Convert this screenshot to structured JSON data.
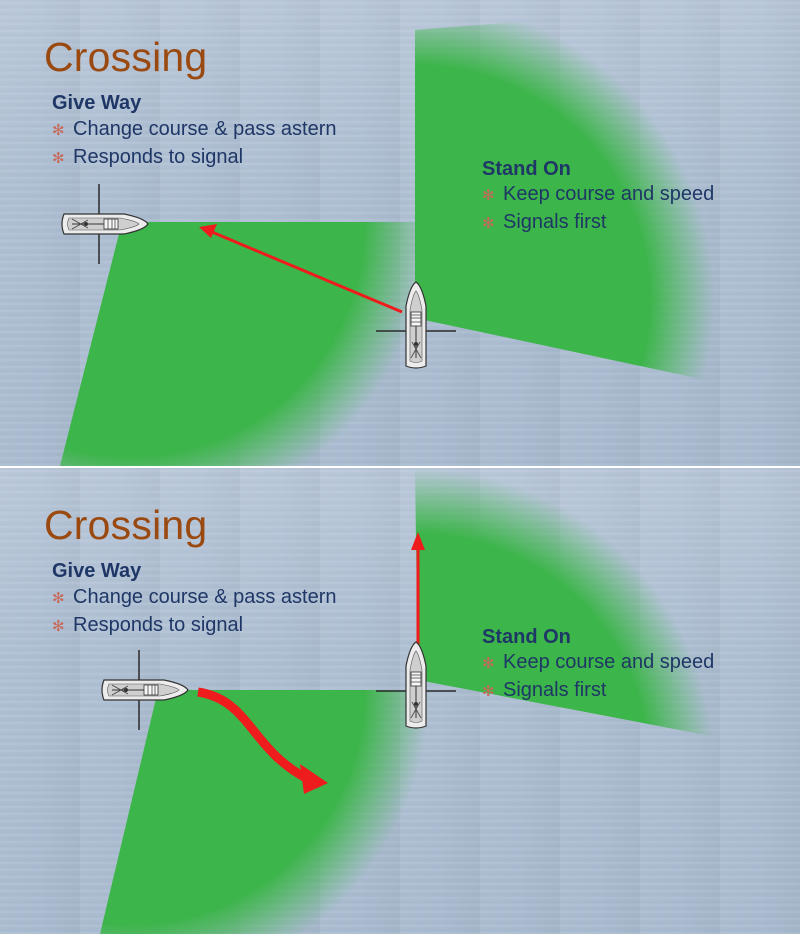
{
  "slides": [
    {
      "title": "Crossing",
      "give_way": {
        "heading": "Give Way",
        "bullets": [
          "Change course & pass astern",
          "Responds to signal"
        ]
      },
      "stand_on": {
        "heading": "Stand On",
        "bullets": [
          "Keep course and speed",
          "Signals first"
        ]
      }
    },
    {
      "title": "Crossing",
      "give_way": {
        "heading": "Give Way",
        "bullets": [
          "Change course & pass astern",
          "Responds to signal"
        ]
      },
      "stand_on": {
        "heading": "Stand On",
        "bullets": [
          "Keep course and speed",
          "Signals first"
        ]
      }
    }
  ],
  "icons": {
    "bullet": "asterisk-bullet-icon",
    "boat": "sailboat-icon"
  },
  "colors": {
    "water": "#aebfd3",
    "sector": "#3cb54a",
    "arrow": "#ee1c1c",
    "title": "#9a4a10",
    "text": "#1f3766",
    "bullet": "#c7695a"
  }
}
